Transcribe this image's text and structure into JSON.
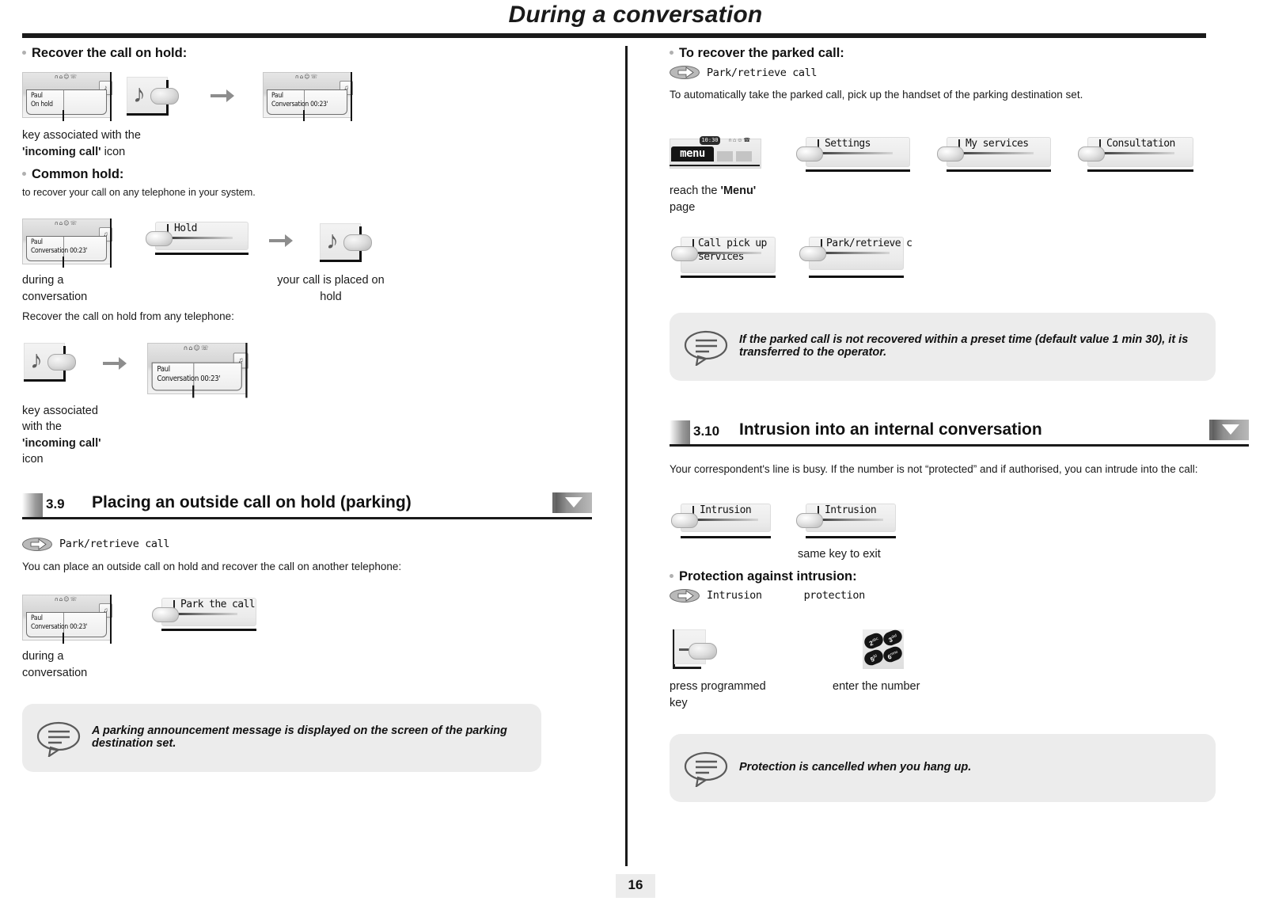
{
  "document": {
    "header_title": "During a conversation",
    "page_number": "16"
  },
  "left_column": {
    "recover_hold": {
      "heading": "Recover the call on hold:",
      "screen_before": {
        "line1": "Paul",
        "line2": "On hold",
        "tab_icon": "handset-icon"
      },
      "notekey_caption": "",
      "screen_after": {
        "line1": "Paul",
        "line2": "Conversation 00:23'",
        "tab_icon": "mic-icon"
      },
      "caption_line1": "key associated with the",
      "caption_bold": "'incoming call'",
      "caption_line2_tail": " icon"
    },
    "common_hold": {
      "heading": "Common hold:",
      "subtext": "to recover your call on any telephone in your system.",
      "screen": {
        "line1": "Paul",
        "line2": "Conversation 00:23'",
        "tab_icon": "mic-icon"
      },
      "softkey": "Hold",
      "caption_left": "during a\nconversation",
      "caption_right": "your call is placed on\nhold",
      "recover_text": "Recover the call on hold from any telephone:",
      "screen2": {
        "line1": "Paul",
        "line2": "Conversation 00:23'",
        "tab_icon": "mic-icon"
      },
      "caption2_l1": "key associated",
      "caption2_l2": "with the",
      "caption2_bold": "'incoming call'",
      "caption2_l4": "icon"
    },
    "section_39": {
      "number": "3.9",
      "title": "Placing an outside call on hold (parking)",
      "feature_code": "Park/retrieve call",
      "intro": "You can place an outside call on hold and recover the call on another telephone:",
      "screen": {
        "line1": "Paul",
        "line2": "Conversation 00:23'",
        "tab_icon": "mic-icon"
      },
      "softkey": "Park the call",
      "caption": "during a\nconversation",
      "note": "A parking announcement message is displayed on the screen of the parking destination set."
    }
  },
  "right_column": {
    "recover_parked": {
      "heading": "To recover the parked call:",
      "feature_code": "Park/retrieve call",
      "intro": "To automatically take the parked call, pick up the handset of the parking destination set.",
      "menu_screen": {
        "label": "menu",
        "clock": "10:30",
        "icons": "∩⌂☺☎"
      },
      "softkeys_row1": [
        "Settings",
        "My services",
        "Consultation"
      ],
      "menu_caption_l1": "reach the ",
      "menu_caption_bold": "'Menu'",
      "menu_caption_l2": "page",
      "softkeys_row2": [
        "Call pick up services",
        "Park/retrieve c"
      ],
      "note": "If the parked call is not recovered within a preset time (default value 1 min 30), it is transferred to the operator."
    },
    "section_310": {
      "number": "3.10",
      "title": "Intrusion into an internal conversation",
      "intro": "Your correspondent's line is busy. If the number is not “protected” and if authorised, you can intrude into the call:",
      "softkey_1": "Intrusion",
      "softkey_2": "Intrusion",
      "caption_exit": "same key to exit",
      "protection_heading": "Protection against intrusion:",
      "protection_code_1": "Intrusion",
      "protection_code_2": "protection",
      "caption_progkey": "press programmed\nkey",
      "caption_keypad": "enter the number",
      "keypad_keys": [
        "2",
        "3",
        "5",
        "6"
      ],
      "keypad_sublabels": [
        "abc",
        "def",
        "jkl",
        "mno"
      ],
      "note": "Protection is cancelled when you hang up."
    }
  }
}
